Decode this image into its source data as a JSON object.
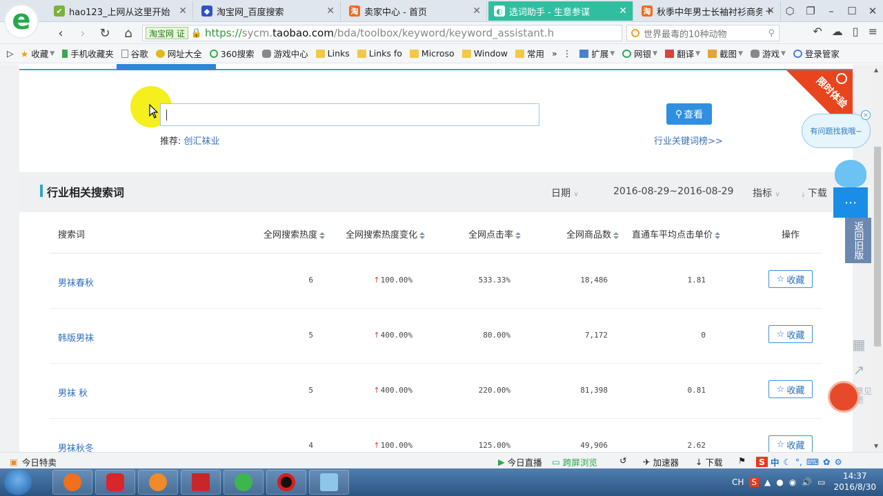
{
  "browser": {
    "logo_letter": "e",
    "tabs": [
      {
        "title": "hao123_上网从这里开始",
        "color": "#7bb23a",
        "fav": "✔",
        "active": false
      },
      {
        "title": "淘宝网_百度搜索",
        "color": "#2f53c5",
        "fav": "🐾",
        "active": false
      },
      {
        "title": "卖家中心 - 首页",
        "color": "#f06a1a",
        "fav": "淘",
        "active": false
      },
      {
        "title": "选词助手 - 生意参谋",
        "color": "#ffffff",
        "fav": "◐",
        "active": true
      },
      {
        "title": "秋季中年男士长袖衬衫商务休",
        "color": "#f06a1a",
        "fav": "淘",
        "active": false
      }
    ],
    "address": {
      "badge": "淘宝网 证",
      "scheme": "https://",
      "host_prefix": "sycm.",
      "host": "taobao.com",
      "path": "/bda/toolbox/keyword/keyword_assistant.h"
    },
    "search_placeholder": "世界最毒的10种动物",
    "bookmarks": [
      {
        "label": "收藏",
        "type": "star",
        "chev": true
      },
      {
        "label": "手机收藏夹",
        "type": "phone"
      },
      {
        "label": "谷歌",
        "type": "page"
      },
      {
        "label": "网址大全",
        "type": "globe"
      },
      {
        "label": "360搜索",
        "type": "o"
      },
      {
        "label": "游戏中心",
        "type": "game"
      },
      {
        "label": "Links",
        "type": "folder"
      },
      {
        "label": "Links fo",
        "type": "folder"
      },
      {
        "label": "Microso",
        "type": "folder"
      },
      {
        "label": "Window",
        "type": "folder"
      },
      {
        "label": "常用",
        "type": "folder"
      },
      {
        "label": "»",
        "type": "none"
      },
      {
        "label": "扩展",
        "type": "ext",
        "chev": true
      },
      {
        "label": "网银",
        "type": "bank",
        "chev": true
      },
      {
        "label": "翻译",
        "type": "trans",
        "chev": true
      },
      {
        "label": "截图",
        "type": "shot",
        "chev": true
      },
      {
        "label": "游戏",
        "type": "game",
        "chev": true
      },
      {
        "label": "登录管家",
        "type": "key"
      }
    ]
  },
  "page": {
    "ribbon_text": "限时体验",
    "search_button": "查看",
    "recommend_label": "推荐:",
    "recommend_value": "创汇袜业",
    "industry_link": "行业关键词榜>>",
    "section_title": "行业相关搜索词",
    "date_label": "日期",
    "date_range": "2016-08-29~2016-08-29",
    "metric_label": "指标",
    "download_label": "下载",
    "columns": [
      "搜索词",
      "全网搜索热度",
      "全网搜索热度变化",
      "全网点击率",
      "全网商品数",
      "直通车平均点击单价",
      "操作"
    ],
    "rows": [
      {
        "keyword": "男袜春秋",
        "heat": "6",
        "change": "100.00%",
        "ctr": "533.33%",
        "items": "18,486",
        "cpc": "1.81",
        "action": "收藏"
      },
      {
        "keyword": "韩版男袜",
        "heat": "5",
        "change": "400.00%",
        "ctr": "80.00%",
        "items": "7,172",
        "cpc": "0",
        "action": "收藏"
      },
      {
        "keyword": "男袜 秋",
        "heat": "5",
        "change": "400.00%",
        "ctr": "220.00%",
        "items": "81,398",
        "cpc": "0.81",
        "action": "收藏"
      },
      {
        "keyword": "男袜秋冬",
        "heat": "4",
        "change": "100.00%",
        "ctr": "125.00%",
        "items": "49,906",
        "cpc": "2.62",
        "action": "收藏"
      }
    ],
    "help_bubble": "有问题找我哦~",
    "old_version": "返回旧版",
    "feedback_text": "意见反馈"
  },
  "statusbar": {
    "left": "今日特卖",
    "items": [
      "今日直播",
      "跨屏浏览",
      "加速器",
      "下载"
    ],
    "ime": "中"
  },
  "taskbar": {
    "time": "14:37",
    "date": "2016/8/30",
    "lang": "CH"
  }
}
